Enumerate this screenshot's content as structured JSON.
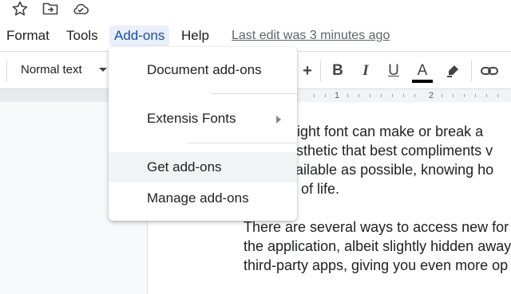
{
  "title_icons": [
    "star-icon",
    "move-to-folder-icon",
    "cloud-saved-icon"
  ],
  "menubar": {
    "items": [
      "Format",
      "Tools",
      "Add-ons",
      "Help"
    ],
    "active": "Add-ons",
    "last_edit": "Last edit was 3 minutes ago"
  },
  "toolbar": {
    "style_value": "Normal text",
    "plus_label": "+",
    "bold_label": "B",
    "italic_label": "I",
    "underline_label": "U",
    "text_color_label": "A",
    "text_color": "#000000",
    "icons": [
      "plus-icon",
      "bold-icon",
      "italic-icon",
      "underline-icon",
      "text-color-icon",
      "highlight-icon",
      "link-icon"
    ]
  },
  "ruler": {
    "labels": [
      "1",
      "2"
    ]
  },
  "addons_menu": {
    "items": [
      {
        "label": "Document add-ons",
        "submenu": false
      },
      {
        "label": "Extensis Fonts",
        "submenu": true
      },
      {
        "label": "Get add-ons",
        "submenu": false,
        "highlighted": true
      },
      {
        "label": "Manage add-ons",
        "submenu": false
      }
    ]
  },
  "document": {
    "lines": [
      "he right font can make or break a",
      "aesthetic that best compliments v",
      "available as possible, knowing ho",
      "rth of life.",
      "There are several ways to access new for",
      "the application, albeit slightly hidden away",
      "third-party apps, giving you even more op"
    ]
  },
  "colors": {
    "menu_active_bg": "#e8f0fe",
    "hover_bg": "#f1f3f4"
  }
}
